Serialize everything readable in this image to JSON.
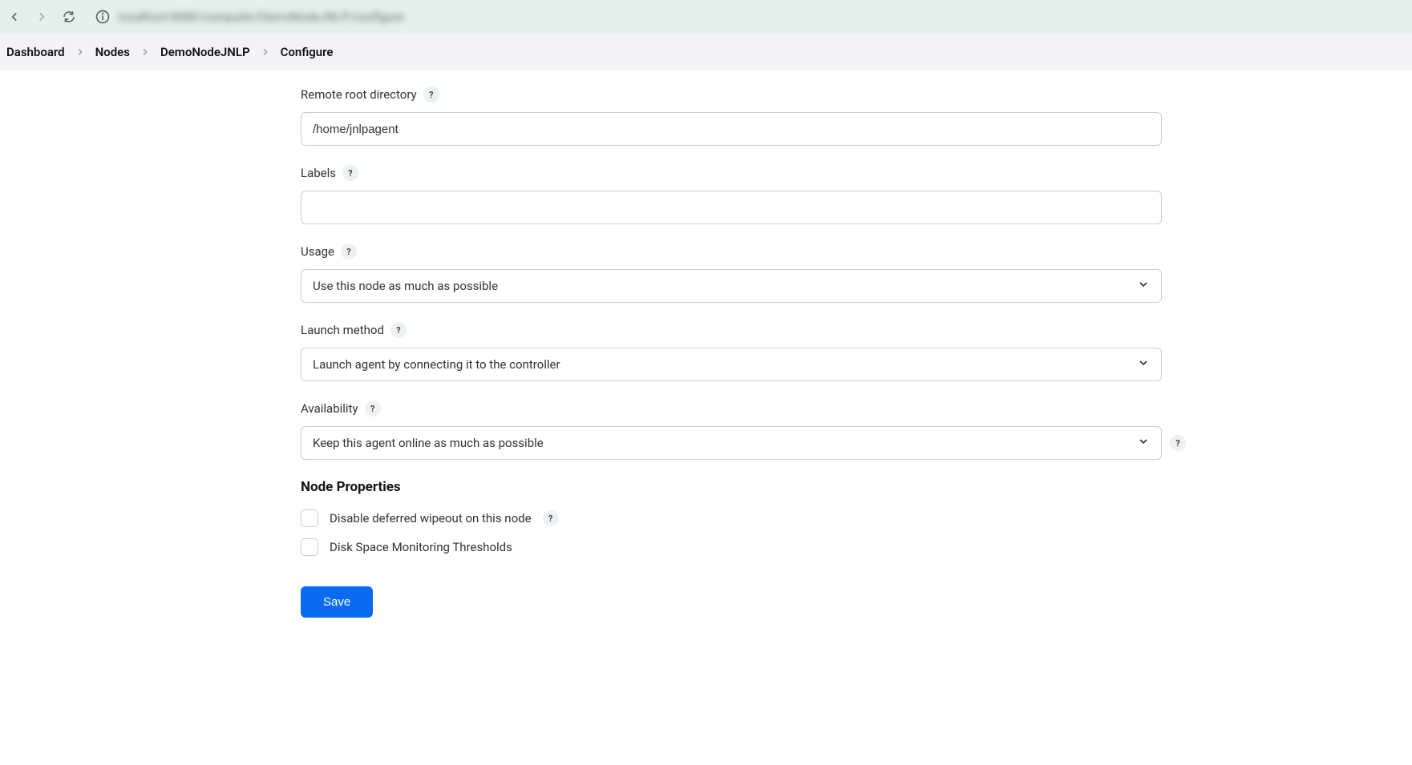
{
  "browser": {
    "url": "localhost:8080/computer/DemoNodeJNLP/configure"
  },
  "breadcrumb": {
    "items": [
      "Dashboard",
      "Nodes",
      "DemoNodeJNLP",
      "Configure"
    ]
  },
  "form": {
    "remote_root": {
      "label": "Remote root directory",
      "value": "/home/jnlpagent"
    },
    "labels": {
      "label": "Labels",
      "value": ""
    },
    "usage": {
      "label": "Usage",
      "value": "Use this node as much as possible"
    },
    "launch_method": {
      "label": "Launch method",
      "value": "Launch agent by connecting it to the controller"
    },
    "availability": {
      "label": "Availability",
      "value": "Keep this agent online as much as possible"
    },
    "section_heading": "Node Properties",
    "checkboxes": {
      "disable_wipeout": "Disable deferred wipeout on this node",
      "disk_space": "Disk Space Monitoring Thresholds"
    },
    "save_label": "Save"
  }
}
